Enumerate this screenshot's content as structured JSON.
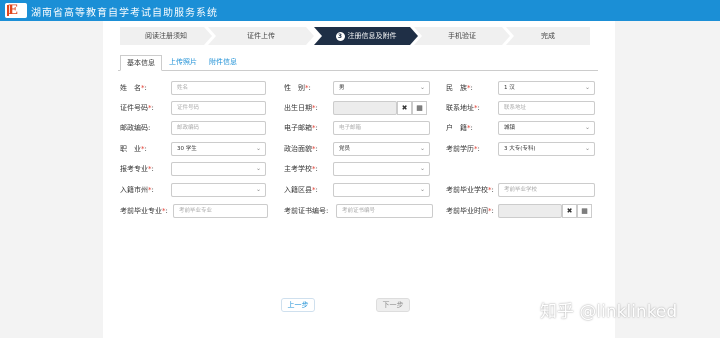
{
  "header": {
    "title": "湖南省高等教育自学考试自助服务系统",
    "logo_icon": "exam-logo-icon"
  },
  "steps": [
    {
      "label": "阅读注册须知",
      "active": false
    },
    {
      "label": "证件上传",
      "active": false
    },
    {
      "label": "注册信息及附件",
      "number": "3",
      "active": true
    },
    {
      "label": "手机验证",
      "active": false
    },
    {
      "label": "完成",
      "active": false
    }
  ],
  "tabs": {
    "basic": "基本信息",
    "photo": "上传照片",
    "attach": "附件信息"
  },
  "form": {
    "name": {
      "label": "姓　名",
      "placeholder": "姓名"
    },
    "gender": {
      "label": "性　别",
      "value": "男"
    },
    "ethnicity": {
      "label": "民　族",
      "value": "1 汉"
    },
    "id_no": {
      "label": "证件号码",
      "placeholder": "证件号码"
    },
    "birth": {
      "label": "出生日期"
    },
    "address": {
      "label": "联系地址",
      "placeholder": "联系地址"
    },
    "postcode": {
      "label": "邮政编码",
      "placeholder": "邮政编码"
    },
    "email": {
      "label": "电子邮箱",
      "placeholder": "电子邮箱"
    },
    "hukou": {
      "label": "户　籍",
      "value": "城镇"
    },
    "job": {
      "label": "职　业",
      "value": "30 学生"
    },
    "politics": {
      "label": "政治面貌",
      "value": "党员"
    },
    "education": {
      "label": "考前学历",
      "value": "3 大专(专科)"
    },
    "major": {
      "label": "报考专业"
    },
    "main_school": {
      "label": "主考学校"
    },
    "city": {
      "label": "入籍市州"
    },
    "district": {
      "label": "入籍区县"
    },
    "grad_school": {
      "label": "考前毕业学校",
      "placeholder": "考前毕业学校"
    },
    "grad_major": {
      "label": "考前毕业专业",
      "placeholder": "考前毕业专业"
    },
    "cert_no": {
      "label": "考前证书编号",
      "placeholder": "考前证书编号"
    },
    "grad_time": {
      "label": "考前毕业时间"
    }
  },
  "buttons": {
    "prev": "上一步",
    "next": "下一步",
    "clear_icon": "clear-icon",
    "calendar_icon": "calendar-icon"
  },
  "watermark": "知乎 @linklinked"
}
